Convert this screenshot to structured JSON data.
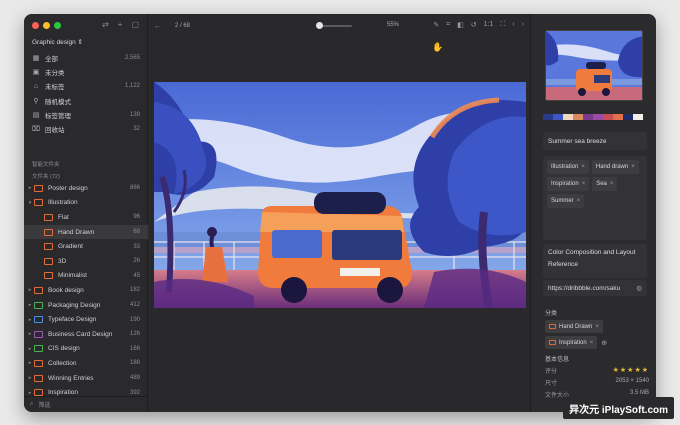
{
  "sidebar": {
    "library_name": "Graphic design ⇕",
    "nav": [
      {
        "icon": "grid",
        "label": "全部",
        "count": "2,565"
      },
      {
        "icon": "box",
        "label": "未分类",
        "count": ""
      },
      {
        "icon": "tag",
        "label": "未标签",
        "count": "1,122"
      },
      {
        "icon": "shuffle",
        "label": "随机模式",
        "count": ""
      },
      {
        "icon": "tag-manage",
        "label": "标签管理",
        "count": "139"
      },
      {
        "icon": "trash",
        "label": "回收站",
        "count": "32"
      }
    ],
    "smart_folders_heading": "智能文件夹",
    "folders_heading": "文件夹 (72)",
    "folders": [
      {
        "label": "Poster design",
        "count": "886",
        "color": "#e46b3c",
        "arrow": "▸",
        "indent": 0,
        "selected": false
      },
      {
        "label": "Illustration",
        "count": "",
        "color": "#e46b3c",
        "arrow": "▾",
        "indent": 0,
        "selected": false
      },
      {
        "label": "Flat",
        "count": "96",
        "color": "#e46b3c",
        "arrow": "",
        "indent": 1,
        "selected": false
      },
      {
        "label": "Hand Drawn",
        "count": "68",
        "color": "#e46b3c",
        "arrow": "",
        "indent": 1,
        "selected": true
      },
      {
        "label": "Gradient",
        "count": "33",
        "color": "#e46b3c",
        "arrow": "",
        "indent": 1,
        "selected": false
      },
      {
        "label": "3D",
        "count": "26",
        "color": "#e46b3c",
        "arrow": "",
        "indent": 1,
        "selected": false
      },
      {
        "label": "Minimalist",
        "count": "45",
        "color": "#e46b3c",
        "arrow": "",
        "indent": 1,
        "selected": false
      },
      {
        "label": "Book design",
        "count": "182",
        "color": "#e46b3c",
        "arrow": "▸",
        "indent": 0,
        "selected": false
      },
      {
        "label": "Packaging Design",
        "count": "412",
        "color": "#4caf50",
        "arrow": "▸",
        "indent": 0,
        "selected": false
      },
      {
        "label": "Typeface Design",
        "count": "190",
        "color": "#4a90e2",
        "arrow": "▸",
        "indent": 0,
        "selected": false
      },
      {
        "label": "Business Card Design",
        "count": "126",
        "color": "#9b59b6",
        "arrow": "▸",
        "indent": 0,
        "selected": false
      },
      {
        "label": "CIS design",
        "count": "166",
        "color": "#4caf50",
        "arrow": "▸",
        "indent": 0,
        "selected": false
      },
      {
        "label": "Collection",
        "count": "188",
        "color": "#e46b3c",
        "arrow": "▸",
        "indent": 0,
        "selected": false
      },
      {
        "label": "Winning Entries",
        "count": "489",
        "color": "#e46b3c",
        "arrow": "▸",
        "indent": 0,
        "selected": false
      },
      {
        "label": "Inspiration",
        "count": "392",
        "color": "#e46b3c",
        "arrow": "▸",
        "indent": 0,
        "selected": false
      }
    ],
    "filter_placeholder": "筛选"
  },
  "toolbar": {
    "page_indicator": "2 / 68",
    "zoom": "55%"
  },
  "inspector": {
    "palette": [
      "#2a3a8a",
      "#3d56c2",
      "#f2d7c0",
      "#d98a5e",
      "#7a3b8f",
      "#9c4aa3",
      "#c94d54",
      "#e0714a",
      "#1f2a6b",
      "#f1efe8"
    ],
    "name": "Summer sea breeze",
    "tags": [
      "Illustration",
      "Hand drawn",
      "Inspiration",
      "Sea",
      "Summer"
    ],
    "note": "Color Composition and Layout Reference",
    "url": "https://dribbble.com/saku",
    "category_heading": "分类",
    "categories": [
      "Hand Drawn",
      "Inspiration"
    ],
    "info_heading": "基本信息",
    "rating_label": "评分",
    "rating": 5,
    "size_label": "尺寸",
    "size_value": "2053 × 1540",
    "filesize_label": "文件大小",
    "filesize_value": "3.5 MB"
  },
  "watermark": "异次元 iPlaySoft.com"
}
